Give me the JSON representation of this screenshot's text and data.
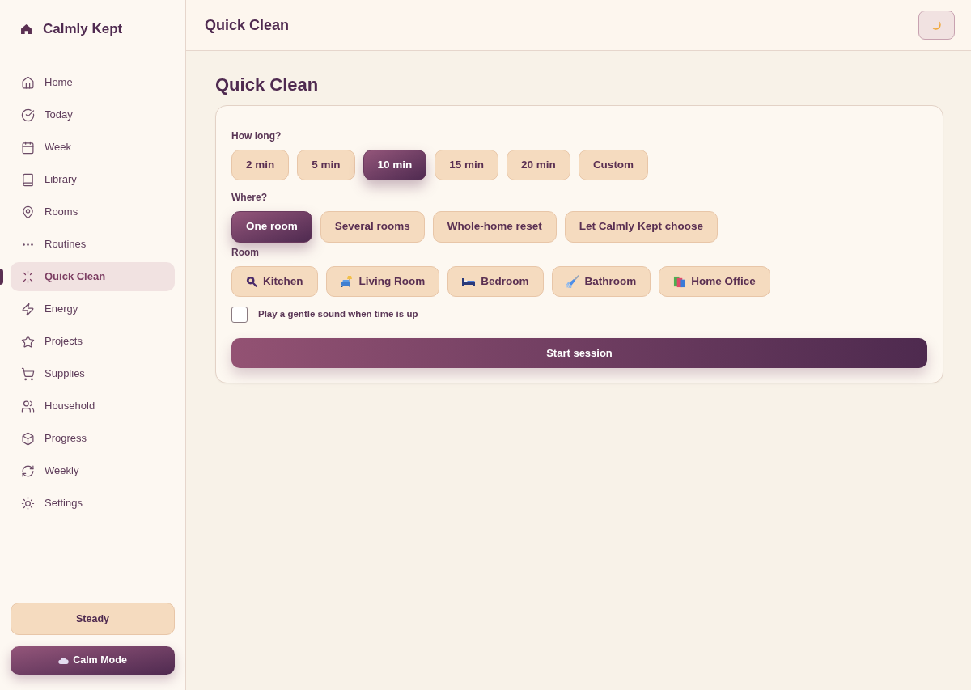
{
  "sidebar": {
    "brand": "Calmly Kept",
    "items": [
      {
        "label": "Home",
        "selected": false
      },
      {
        "label": "Today",
        "selected": false
      },
      {
        "label": "Week",
        "selected": false
      },
      {
        "label": "Library",
        "selected": false
      },
      {
        "label": "Rooms",
        "selected": false
      },
      {
        "label": "Routines",
        "selected": false
      },
      {
        "label": "Quick Clean",
        "selected": true
      },
      {
        "label": "Energy",
        "selected": false
      },
      {
        "label": "Projects",
        "selected": false
      },
      {
        "label": "Supplies",
        "selected": false
      },
      {
        "label": "Household",
        "selected": false
      },
      {
        "label": "Progress",
        "selected": false
      },
      {
        "label": "Weekly",
        "selected": false
      },
      {
        "label": "Settings",
        "selected": false
      }
    ],
    "steady_button": "Steady",
    "calm_mode_button": "Calm Mode"
  },
  "header": {
    "title": "Quick Clean"
  },
  "page": {
    "heading": "Quick Clean",
    "groups": [
      {
        "kind": "duration",
        "label": "How long?",
        "options": [
          {
            "label": "2 min",
            "selected": false
          },
          {
            "label": "5 min",
            "selected": false
          },
          {
            "label": "10 min",
            "selected": true
          },
          {
            "label": "15 min",
            "selected": false
          },
          {
            "label": "20 min",
            "selected": false
          },
          {
            "label": "Custom",
            "selected": false
          }
        ]
      },
      {
        "kind": "scope",
        "label": "Where?",
        "options": [
          {
            "label": "One room",
            "selected": true
          },
          {
            "label": "Several rooms",
            "selected": false
          },
          {
            "label": "Whole-home reset",
            "selected": false
          },
          {
            "label": "Let Calmly Kept choose",
            "selected": false
          }
        ]
      },
      {
        "kind": "room",
        "label": "Room",
        "options": [
          {
            "label": "Kitchen",
            "selected": false
          },
          {
            "label": "Living Room",
            "selected": false
          },
          {
            "label": "Bedroom",
            "selected": false
          },
          {
            "label": "Bathroom",
            "selected": false
          },
          {
            "label": "Home Office",
            "selected": false
          }
        ]
      }
    ],
    "sound_option": {
      "label": "Play a gentle sound when time is up",
      "checked": false
    },
    "start_button": "Start session"
  }
}
